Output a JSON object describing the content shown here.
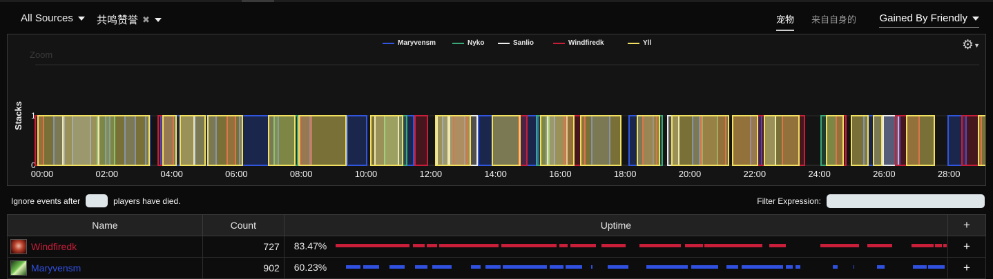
{
  "toolbar": {
    "source_label": "All Sources",
    "aura_label": "共鸣赞誉",
    "aura_clear_icon": "close-icon",
    "seg_pets": "宠物",
    "seg_self": "来自自身的",
    "mode_label": "Gained By Friendly"
  },
  "chart_data": {
    "type": "area",
    "ylabel": "Stacks",
    "zoom_label": "Zoom",
    "ylim": [
      0,
      1
    ],
    "yticks": [
      "0",
      "1"
    ],
    "x_ticks": [
      "00:00",
      "02:00",
      "04:00",
      "06:00",
      "08:00",
      "10:00",
      "12:00",
      "14:00",
      "16:00",
      "18:00",
      "20:00",
      "22:00",
      "24:00",
      "26:00",
      "28:00"
    ],
    "legend_position": "top-center",
    "grid": true,
    "series": [
      {
        "name": "Maryvensm",
        "color": "#3056e0",
        "intervals": [
          [
            27,
            42
          ],
          [
            54,
            80
          ],
          [
            102,
            108
          ],
          [
            130,
            145
          ],
          [
            160,
            166
          ],
          [
            182,
            210
          ],
          [
            232,
            262
          ],
          [
            296,
            352
          ],
          [
            384,
            398
          ],
          [
            452,
            480
          ],
          [
            526,
            548
          ],
          [
            590,
            622
          ],
          [
            642,
            702
          ],
          [
            702,
            728
          ],
          [
            740,
            752
          ],
          [
            806,
            832
          ],
          [
            860,
            895
          ],
          [
            952,
            962
          ],
          [
            1036,
            1052
          ],
          [
            1200,
            1252
          ],
          [
            1322,
            1348
          ]
        ]
      },
      {
        "name": "Nyko",
        "color": "#3aa878",
        "intervals": [
          [
            90,
            115
          ],
          [
            346,
            380
          ],
          [
            506,
            538
          ],
          [
            726,
            744
          ],
          [
            880,
            908
          ],
          [
            966,
            988
          ],
          [
            1138,
            1160
          ]
        ]
      },
      {
        "name": "Sanlio",
        "color": "#ededed",
        "intervals": [
          [
            40,
            92
          ],
          [
            210,
            230
          ],
          [
            492,
            526
          ],
          [
            582,
            598
          ],
          [
            600,
            640
          ],
          [
            742,
            770
          ],
          [
            916,
            932
          ],
          [
            1056,
            1072
          ],
          [
            1228,
            1250
          ]
        ]
      },
      {
        "name": "Windfiredk",
        "color": "#c81e3a",
        "intervals": [
          [
            0,
            12
          ],
          [
            178,
            200
          ],
          [
            278,
            290
          ],
          [
            384,
            400
          ],
          [
            550,
            568
          ],
          [
            606,
            626
          ],
          [
            700,
            712
          ],
          [
            766,
            796
          ],
          [
            880,
            900
          ],
          [
            964,
            1000
          ],
          [
            1010,
            1056
          ],
          [
            1082,
            1114
          ],
          [
            1160,
            1174
          ],
          [
            1246,
            1280
          ],
          [
            1342,
            1370
          ]
        ]
      },
      {
        "name": "Yll",
        "color": "#f2e060",
        "intervals": [
          [
            4,
            165
          ],
          [
            185,
            204
          ],
          [
            210,
            246
          ],
          [
            250,
            300
          ],
          [
            338,
            376
          ],
          [
            382,
            450
          ],
          [
            486,
            532
          ],
          [
            580,
            630
          ],
          [
            662,
            702
          ],
          [
            732,
            780
          ],
          [
            790,
            848
          ],
          [
            872,
            904
          ],
          [
            922,
            1004
          ],
          [
            1010,
            1046
          ],
          [
            1056,
            1106
          ],
          [
            1146,
            1170
          ],
          [
            1182,
            1206
          ],
          [
            1214,
            1226
          ],
          [
            1262,
            1302
          ],
          [
            1366,
            1410
          ]
        ]
      }
    ]
  },
  "controls": {
    "ignore_prefix": "Ignore events after",
    "ignore_suffix": "players have died.",
    "filter_label": "Filter Expression:"
  },
  "table": {
    "headers": {
      "name": "Name",
      "count": "Count",
      "uptime": "Uptime",
      "add": "+"
    },
    "rows": [
      {
        "name": "Windfiredk",
        "color": "#c81e3a",
        "icon": "death-knight-class-icon",
        "count": "727",
        "uptime": "83.47%",
        "add": "+",
        "segments": [
          [
            0,
            107
          ],
          [
            112,
            129
          ],
          [
            132,
            147
          ],
          [
            150,
            236
          ],
          [
            240,
            320
          ],
          [
            324,
            336
          ],
          [
            340,
            377
          ],
          [
            385,
            420
          ],
          [
            440,
            500
          ],
          [
            506,
            532
          ],
          [
            534,
            618
          ],
          [
            628,
            652
          ],
          [
            702,
            758
          ],
          [
            770,
            806
          ],
          [
            834,
            866
          ],
          [
            868,
            878
          ],
          [
            880,
            894
          ]
        ]
      },
      {
        "name": "Maryvensm",
        "color": "#3050e0",
        "icon": "hunter-class-icon",
        "count": "902",
        "uptime": "60.23%",
        "add": "+",
        "segments": [
          [
            15,
            36
          ],
          [
            40,
            63
          ],
          [
            78,
            100
          ],
          [
            115,
            133
          ],
          [
            140,
            168
          ],
          [
            196,
            210
          ],
          [
            217,
            239
          ],
          [
            242,
            306
          ],
          [
            310,
            330
          ],
          [
            333,
            357
          ],
          [
            370,
            372
          ],
          [
            394,
            424
          ],
          [
            450,
            510
          ],
          [
            515,
            554
          ],
          [
            566,
            583
          ],
          [
            588,
            648
          ],
          [
            652,
            662
          ],
          [
            666,
            673
          ],
          [
            720,
            727
          ],
          [
            750,
            751
          ],
          [
            784,
            795
          ],
          [
            836,
            856
          ],
          [
            858,
            882
          ]
        ]
      }
    ]
  }
}
